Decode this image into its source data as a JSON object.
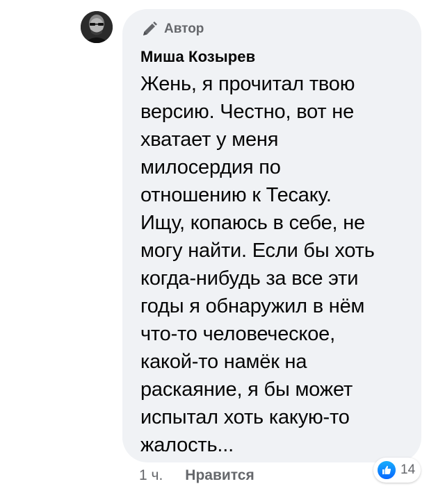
{
  "comment": {
    "badge": {
      "icon": "pencil-icon",
      "label": "Автор"
    },
    "author_name": "Миша Козырев",
    "text": "Жень, я прочитал твою\nверсию.  Честно, вот не\nхватает у меня\nмилосердия по\nотношению к Тесаку.\nИщу, копаюсь  в себе, не\nмогу найти. Если бы хоть\nкогда-нибудь за все эти\nгоды я обнаружил в нём\nчто-то человеческое,\nкакой-то намёк на\nраскаяние, я бы может\nиспытал хоть какую-то\nжалость...",
    "timestamp": "1 ч.",
    "like_action": "Нравится",
    "reactions": {
      "icon": "like-icon",
      "count": "14",
      "color": "#1877f2"
    },
    "bubble_color": "#f0f2f5"
  }
}
